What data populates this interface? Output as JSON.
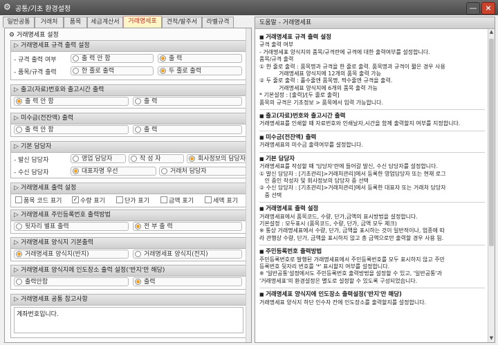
{
  "window": {
    "title": "공통/기초 환경설정",
    "min": "—",
    "close": "×"
  },
  "tabs": [
    "일반공통",
    "거래처",
    "품목",
    "세금계산서",
    "거래명세표",
    "견적/발주서",
    "라벨규격"
  ],
  "panel": {
    "title": "거래명세표 설정",
    "icon": "gear-icon"
  },
  "sections": {
    "spec": {
      "title": "거래명세표 규격 출력 설정",
      "row1": {
        "label": "- 규격 출력 여부",
        "opt1": "출 력 안 함",
        "opt2": "출           력"
      },
      "row2": {
        "label": "- 품목/규격 출력",
        "opt1": "한 줄로 출력",
        "opt2": "두 줄로 출력"
      }
    },
    "outin": {
      "title": "출고(자료)번호와 출고시간 출력",
      "opt1": "출 력 안 함",
      "opt2": "출           력"
    },
    "unpaid": {
      "title": "미수금(전잔액) 출력",
      "opt1": "출 력 안 함",
      "opt2": "출           력"
    },
    "manager": {
      "title": "기본 담당자",
      "row1": {
        "label": "- 발신 담당자",
        "opt1": "영업 담당자",
        "opt2": "작 성 자",
        "opt3": "회사정보의 담당자"
      },
      "row2": {
        "label": "- 수신 담당자",
        "opt1": "대표자명 우선",
        "opt2": "거래처 담당자"
      }
    },
    "items": {
      "title": "거래명세표 출력 설정",
      "checks": [
        "품목 코드 표기",
        "수량 표기",
        "단가 표기",
        "금액 표기",
        "세액 표기"
      ],
      "checked": [
        false,
        true,
        false,
        false,
        false
      ]
    },
    "rrn": {
      "title": "거래명세표 주민등록번호 출력방법",
      "opt1": "뒷자리 별표 출력",
      "opt2": "전 부 출 력"
    },
    "form": {
      "title": "거래명세표 양식지 기본출력",
      "opt1": "거래명세표 양식지(반지)",
      "opt2": "거래명세표 양식지(전지)"
    },
    "stamp": {
      "title": "거래명세표 양식지에 인도장소 출력 설정('반지'만 해당)",
      "opt1": "출력안함",
      "opt2": "출력"
    },
    "memo": {
      "title": "거래명세표 공통 참고사항",
      "value": "계좌번호입니다."
    }
  },
  "help": {
    "header": "도움말 - 거래명세표",
    "s1": {
      "title": "거래명세표 규격 출력 설정",
      "body": "규격 출력 여부\n- 거래명세표 양식지의 품목/규격란에 규격에 대한 출력여부를 설정합니다.\n품목/규격 출력\n① 한 줄로 출력 : 품목명과 규격을 한 줄로 출력. 품목명과 규격이 짧은 경우 사용\n           거래명세표 양식지에 12개의 품목 출력 가능\n② 두 줄로 출력 : 홀수줄엔 품목명, 짝수줄엔 규격을 출력.\n           거래명세표 양식지에 6개의 품목 출력 가능\n* 기본설정 : [출력]/[두 줄로 출력]\n품목의 규격은 기초정보 > 품목에서 입력 가능합니다."
    },
    "s2": {
      "title": "출고(자료)번호와 출고시간 출력",
      "body": "거래명세표를 인쇄할 때 자료번호와 인쇄날자,시간을 함께 출력할지 여부를 지정합니다."
    },
    "s3": {
      "title": "미수금(전잔액) 출력",
      "body": "거래명세표의 미수금 출력여부를 설정합니다."
    },
    "s4": {
      "title": "기본 담당자",
      "body": "거래명세표를 작성할 때 '담당자'란에 들어갈 발신, 수신 담당자를 설정합니다.\n① 발신 담당자 : [기초관리]>거래처관리]에서 등록한 영업담당자 또는 현재 로그\n   인 중인 작성자 및 회사정보의 담당자 중 선택\n② 수신 담당자 : [기초관리]>거래처관리]에서 등록한 대표자 또는 거래처 담당자\n   중 선택"
    },
    "s5": {
      "title": "거래명세표 출력 설정",
      "body": "거래명세표에서 품목코드, 수량, 단가,금액의 표시방법을 설정합니다.\n기본설정 : 모두표시 (품목코드, 수량, 단가, 금액 모두 체크)\n※ 통상 거래명세표에서 수량, 단가, 금액을 표시하는 것이 일반적이나, 업종에 따\n라 관행상 수량, 단가, 금액을 표시하지 않고 총 금액으로만 출력할 경우 사용 됨."
    },
    "s6": {
      "title": "주민등록번호 출력방법",
      "body": "주민등록번호로 발행된 거래명세표에서 주민등록번호를 모두 표시하지 않고 주민\n등록번호 뒷자리 번호를 '*' 표시할지 여부를 설정합니다.\n※ '일반공통'설정에서도 주민등록번호 출력방법을 설정할 수 있고, '일반공통'과\n'거래명세표'의 환경설정은 별도로 설정할 수 있도록 구성되었습니다."
    },
    "s7": {
      "title": "거래명세표 양식지에 인도장소 출력설정('반지'만 해당)",
      "body": "거래명세표 양식지 하단 인수자 칸에 인도장소를 출력할지를 설정합니다."
    }
  }
}
